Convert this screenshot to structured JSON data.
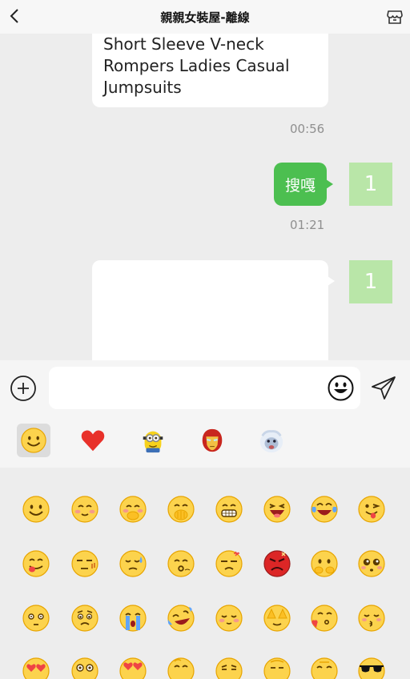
{
  "header": {
    "title": "親親女裝屋-離線",
    "back_icon": "chevron-left-icon",
    "shop_icon": "shop-icon"
  },
  "chat": {
    "incoming_text": "Short Sleeve V-neck Rompers Ladies Casual Jumpsuits",
    "time_1": "00:56",
    "outgoing_text": "搜嘎",
    "avatar_1": "1",
    "time_2": "01:21",
    "avatar_2": "1"
  },
  "input": {
    "value": "",
    "placeholder": ""
  },
  "colors": {
    "accent": "#4cbf50",
    "avatar": "#b9e6a8",
    "heart": "#e8312a"
  },
  "emoji_tabs": [
    "smile-face-tab",
    "heart-tab",
    "minion-tab",
    "ironman-tab",
    "yeti-tab"
  ],
  "emoji_rows": [
    [
      "smile",
      "blush",
      "shy",
      "covering-mouth",
      "grin",
      "laughing",
      "tears-of-joy",
      "wink-tongue"
    ],
    [
      "yummy",
      "awkward",
      "sweat",
      "whistle",
      "dizzy",
      "angry",
      "cover-mouth-embarrassed",
      "pleading"
    ],
    [
      "stunned",
      "worried",
      "crying",
      "rolling-laugh",
      "content",
      "facepalm",
      "blow-kiss",
      "kissing"
    ],
    [
      "heart-eyes",
      "wide-eyes",
      "star-struck",
      "thinking",
      "smirk",
      "shh",
      "nervous",
      "cool-sunglasses"
    ]
  ]
}
